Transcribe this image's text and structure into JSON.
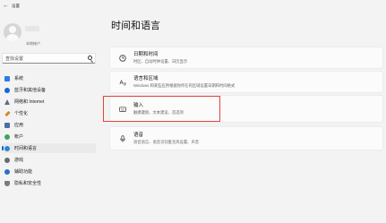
{
  "window": {
    "title": "设置"
  },
  "profile": {
    "subtitle": "本地帐户"
  },
  "search": {
    "placeholder": "查找设置"
  },
  "sidebar": {
    "items": [
      {
        "label": "系统",
        "icon": "system-icon",
        "color": "#2b7de9",
        "selected": false
      },
      {
        "label": "蓝牙和其他设备",
        "icon": "bluetooth-icon",
        "color": "#0b6cd4",
        "selected": false
      },
      {
        "label": "网络和 Internet",
        "icon": "network-icon",
        "color": "#5b6b82",
        "selected": false
      },
      {
        "label": "个性化",
        "icon": "brush-icon",
        "color": "#d08a2a",
        "selected": false
      },
      {
        "label": "应用",
        "icon": "apps-icon",
        "color": "#4a6fa5",
        "selected": false
      },
      {
        "label": "帐户",
        "icon": "account-icon",
        "color": "#3aa65b",
        "selected": false
      },
      {
        "label": "时间和语言",
        "icon": "time-language-icon",
        "color": "#2a85d6",
        "selected": true
      },
      {
        "label": "游戏",
        "icon": "game-icon",
        "color": "#6a6a6a",
        "selected": false
      },
      {
        "label": "辅助功能",
        "icon": "accessibility-icon",
        "color": "#2b6fc5",
        "selected": false
      },
      {
        "label": "隐私和安全性",
        "icon": "privacy-shield-icon",
        "color": "#7a7a7a",
        "selected": false
      }
    ]
  },
  "main": {
    "title": "时间和语言",
    "cards": [
      {
        "title": "日期和时间",
        "subtitle": "时区、自动时钟设置、日历显示",
        "icon": "clock-icon"
      },
      {
        "title": "语言和区域",
        "subtitle": "Windows 和某些应用根据你所在的区域设置日期和时间格式",
        "icon": "globe-language-icon"
      },
      {
        "title": "输入",
        "subtitle": "触摸键盘、文本建议、首选项",
        "icon": "keyboard-icon"
      },
      {
        "title": "语音",
        "subtitle": "语音语言、语音识别麦克风设置、声音",
        "icon": "microphone-icon"
      }
    ]
  },
  "accent": "#1367c0",
  "highlight_color": "#e1453a"
}
